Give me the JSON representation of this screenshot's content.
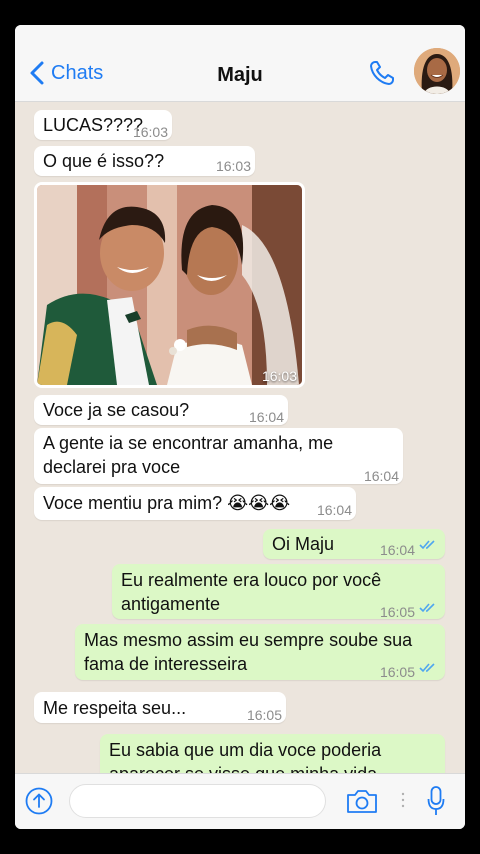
{
  "header": {
    "back_label": "Chats",
    "contact_name": "Maju"
  },
  "colors": {
    "accent": "#1f7cf3",
    "outgoing_bubble": "#dcf8c6",
    "incoming_bubble": "#ffffff",
    "chat_background": "#ece5dd",
    "read_ticks": "#4fa6f0"
  },
  "messages": [
    {
      "dir": "in",
      "text": "LUCAS????",
      "time": "16:03"
    },
    {
      "dir": "in",
      "text": "O que é isso??",
      "time": "16:03"
    },
    {
      "dir": "in",
      "type": "image",
      "image": "wedding photo of a smiling couple",
      "time": "16:03"
    },
    {
      "dir": "in",
      "text": "Voce ja se casou?",
      "time": "16:04"
    },
    {
      "dir": "in",
      "text": "A gente ia se encontrar amanha, me declarei pra voce",
      "time": "16:04"
    },
    {
      "dir": "in",
      "text": "Voce mentiu pra mim? 😭😭😭",
      "time": "16:04"
    },
    {
      "dir": "out",
      "text": "Oi Maju",
      "time": "16:04",
      "read": true
    },
    {
      "dir": "out",
      "text": "Eu realmente era louco por você antigamente",
      "time": "16:05",
      "read": true
    },
    {
      "dir": "out",
      "text": "Mas mesmo assim eu sempre soube sua fama de interesseira",
      "time": "16:05",
      "read": true
    },
    {
      "dir": "in",
      "text": "Me respeita seu...",
      "time": "16:05"
    },
    {
      "dir": "out",
      "text": "Eu sabia que um dia voce poderia aparecer se visse que minha vida",
      "time": "",
      "read": false
    }
  ],
  "icons": {
    "back": "chevron-left-icon",
    "call": "phone-icon",
    "attach": "up-arrow-circle-icon",
    "camera": "camera-icon",
    "mic": "microphone-icon"
  },
  "input": {
    "placeholder": "",
    "value": ""
  }
}
